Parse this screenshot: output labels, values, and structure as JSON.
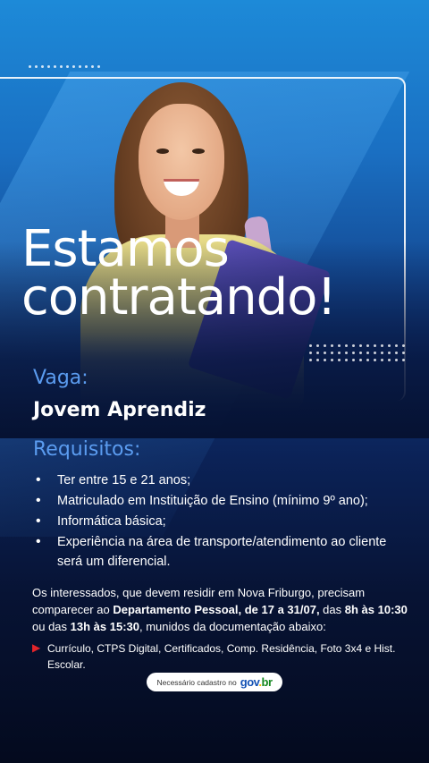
{
  "headline": {
    "line1": "Estamos",
    "line2": "contratando!"
  },
  "vaga": {
    "label": "Vaga:",
    "value": "Jovem Aprendiz"
  },
  "requisitos": {
    "label": "Requisitos:",
    "items": [
      "Ter entre 15 e 21 anos;",
      "Matriculado em Instituição de Ensino (mínimo 9º ano);",
      "Informática básica;",
      "Experiência na área de transporte/atendimento ao cliente será um diferencial."
    ]
  },
  "instrucoes": {
    "p1": "Os interessados, que devem residir em Nova Friburgo, precisam comparecer ao ",
    "b1": "Departamento Pessoal, de 17 a 31/07,",
    "p2": " das ",
    "b2": "8h às 10:30",
    "p3": " ou das ",
    "b3": "13h às 15:30",
    "p4": ", munidos da documentação abaixo:"
  },
  "documentos": "Currículo, CTPS Digital, Certificados, Comp. Residência, Foto 3x4 e Hist. Escolar.",
  "cadastro": {
    "text": "Necessário cadastro no",
    "logo_g": "gov",
    "logo_dot": ".",
    "logo_br": "br"
  },
  "colors": {
    "accent_blue": "#5b9cf0",
    "bullet_arrow": "#e2242a"
  }
}
